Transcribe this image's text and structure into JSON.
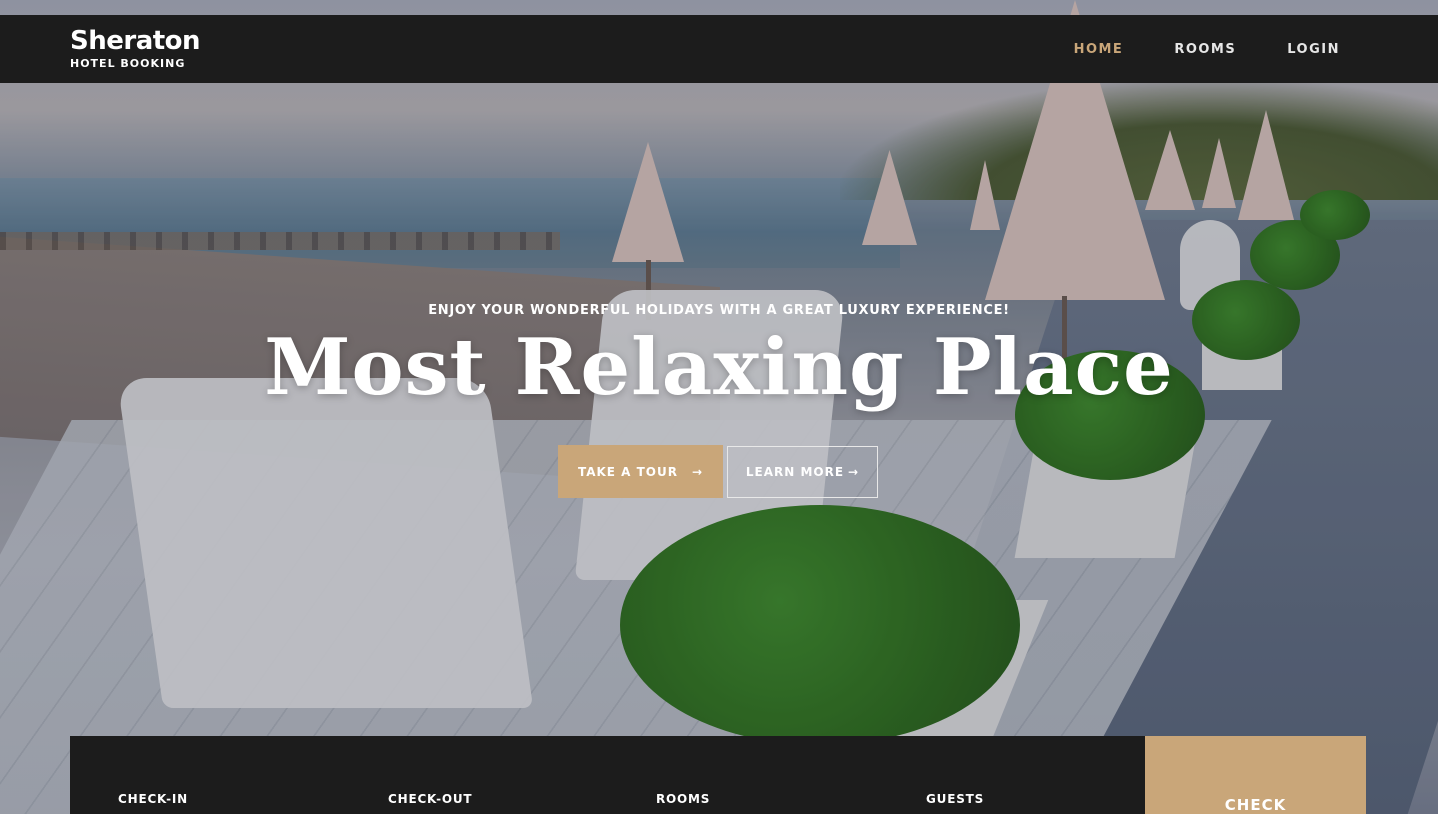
{
  "brand": {
    "name": "Sheraton",
    "subtitle": "HOTEL BOOKING"
  },
  "nav": {
    "items": [
      {
        "label": "HOME",
        "active": true
      },
      {
        "label": "ROOMS",
        "active": false
      },
      {
        "label": "LOGIN",
        "active": false
      }
    ]
  },
  "hero": {
    "tagline": "ENJOY YOUR WONDERFUL HOLIDAYS WITH A GREAT LUXURY EXPERIENCE!",
    "headline": "Most Relaxing Place",
    "primary_button": "TAKE A TOUR",
    "secondary_button": "LEARN MORE"
  },
  "booking": {
    "fields": [
      {
        "label": "CHECK-IN"
      },
      {
        "label": "CHECK-OUT"
      },
      {
        "label": "ROOMS"
      },
      {
        "label": "GUESTS"
      }
    ],
    "submit_label": "CHECK"
  },
  "colors": {
    "accent": "#c9a679",
    "navbar": "#1c1c1c",
    "text_light": "#ffffff"
  }
}
